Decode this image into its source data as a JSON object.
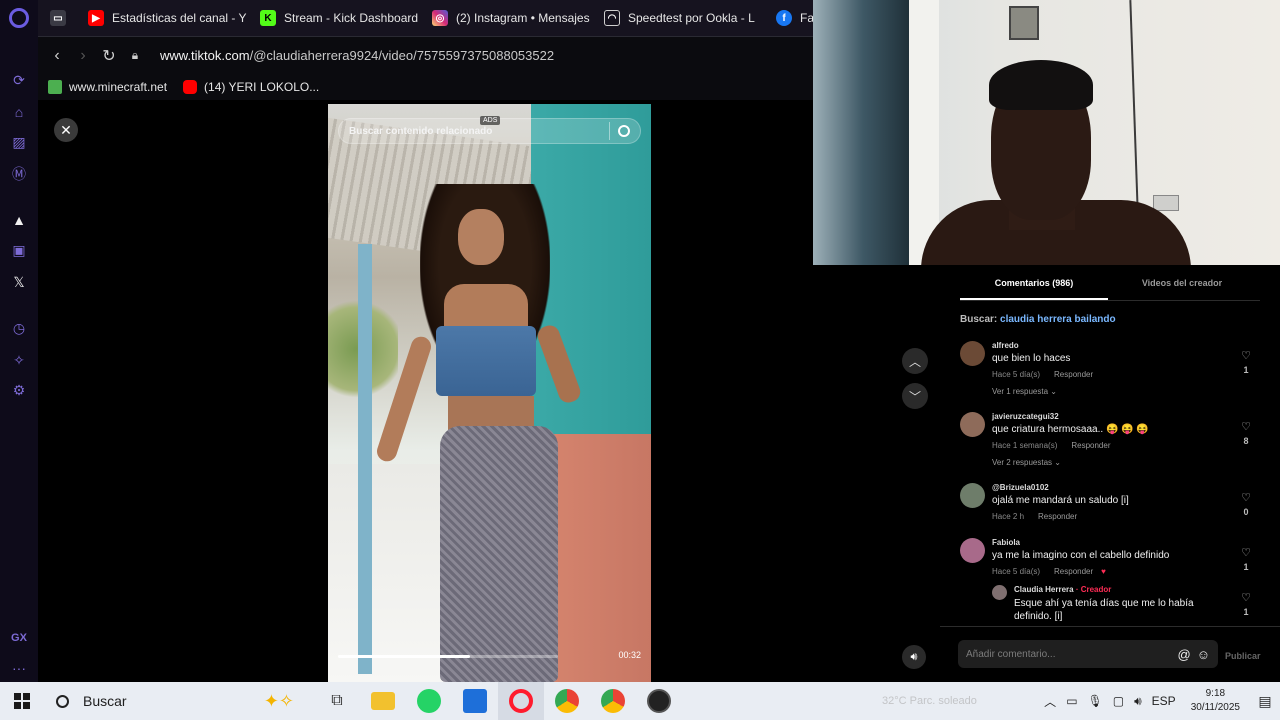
{
  "browser": {
    "tabs": [
      {
        "title": "",
        "icon": "controller-icon",
        "color": "#cfcfcf"
      },
      {
        "title": "Estadísticas del canal - Y",
        "icon": "youtube-icon",
        "color": "#ff0000"
      },
      {
        "title": "Stream - Kick Dashboard",
        "icon": "kick-icon",
        "color": "#53fc18"
      },
      {
        "title": "(2) Instagram • Mensajes",
        "icon": "instagram-icon",
        "color": "#d62976"
      },
      {
        "title": "Speedtest por Ookla - L",
        "icon": "speedtest-icon",
        "color": "#cfcfcf"
      },
      {
        "title": "Fac",
        "icon": "facebook-icon",
        "color": "#1877f2"
      }
    ],
    "url_host": "www.tiktok.com",
    "url_path": "/@claudiaherrera9924/video/7575597375088053522",
    "bookmarks": [
      {
        "label": "www.minecraft.net",
        "icon": "minecraft-icon",
        "color": "#4caf50"
      },
      {
        "label": "(14) YERI LOKOLO...",
        "icon": "youtube-icon",
        "color": "#ff0000"
      }
    ]
  },
  "video": {
    "search_placeholder": "Buscar contenido relacionado",
    "ads_tag": "ADS",
    "time": "00:32",
    "progress": 0.6
  },
  "comments": {
    "tab_comments": "Comentarios (986)",
    "tab_creator": "Videos del creador",
    "search_prefix": "Buscar:",
    "search_link": "claudia herrera bailando",
    "reply_label": "Responder",
    "items": [
      {
        "author": "alfredo",
        "text": "que bien lo haces",
        "time": "Hace 5 día(s)",
        "likes": "1",
        "more": "Ver 1 respuesta",
        "avatar_color": "#6b4a36"
      },
      {
        "author": "javieruzcategui32",
        "text": "que criatura hermosaaa.. 😝 😝 😝",
        "time": "Hace 1 semana(s)",
        "likes": "8",
        "more": "Ver 2 respuestas",
        "avatar_color": "#8e6b5a"
      },
      {
        "author": "@Brizuela0102",
        "text": "ojalá me mandará un saludo [i]",
        "time": "Hace 2 h",
        "likes": "0",
        "more": "",
        "avatar_color": "#6e7d6a"
      },
      {
        "author": "Fabiola",
        "text": "ya me la imagino con el cabello definido",
        "time": "Hace 5 día(s)",
        "likes": "1",
        "more": "",
        "avatar_color": "#a86a8a"
      }
    ],
    "reply": {
      "author": "Claudia Herrera",
      "badge": "· Creador",
      "text": "Esque ahí ya tenía días que me lo había definido. [i]",
      "likes": "1"
    },
    "input_placeholder": "Añadir comentario...",
    "publish_label": "Publicar"
  },
  "taskbar": {
    "search_label": "Buscar",
    "weather": "32°C  Parc. soleado",
    "lang": "ESP",
    "time": "9:18",
    "date": "30/11/2025",
    "apps": [
      {
        "name": "task-view-icon",
        "color": "#444"
      },
      {
        "name": "file-explorer-icon",
        "color": "#f2c12e"
      },
      {
        "name": "whatsapp-icon",
        "color": "#25d366"
      },
      {
        "name": "store-icon",
        "color": "#1e6fd9"
      },
      {
        "name": "opera-icon",
        "color": "#ff1b2d"
      },
      {
        "name": "chrome-icon",
        "color": "#34a853"
      },
      {
        "name": "chrome-profile-icon",
        "color": "#ea4335"
      },
      {
        "name": "obs-icon",
        "color": "#222"
      }
    ]
  }
}
